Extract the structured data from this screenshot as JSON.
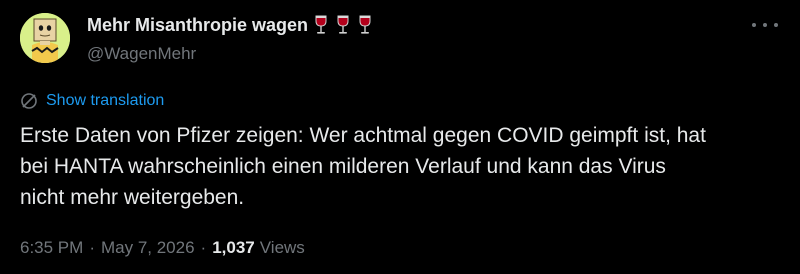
{
  "author": {
    "display_name": "Mehr Misanthropie wagen",
    "handle": "@WagenMehr",
    "emoji_icons": [
      "wine-glass-icon",
      "wine-glass-icon",
      "wine-glass-icon"
    ]
  },
  "translate": {
    "label": "Show translation",
    "icon": "translate-globe-icon"
  },
  "tweet": {
    "text": "Erste Daten von Pfizer zeigen: Wer achtmal gegen COVID geimpft ist, hat\nbei HANTA wahrscheinlich einen milderen Verlauf und kann das Virus\nnicht mehr weitergeben."
  },
  "meta": {
    "time": "6:35 PM",
    "separator": "·",
    "date": "May 7, 2026",
    "views_count": "1,037",
    "views_label": "Views"
  },
  "colors": {
    "background": "#000000",
    "text": "#e7e9ea",
    "secondary": "#71767b",
    "link": "#1d9bf0"
  }
}
